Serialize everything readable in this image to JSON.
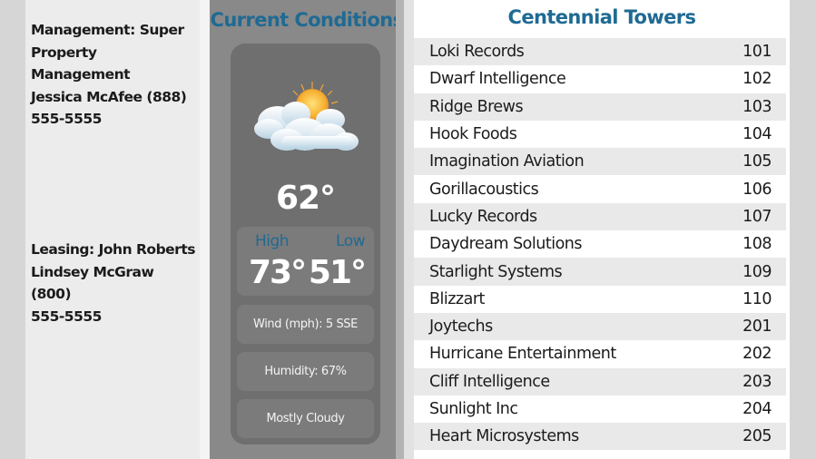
{
  "contacts": {
    "management": {
      "line1": "Management: Super",
      "line2": "Property Management",
      "line3": "Jessica McAfee (888)",
      "line4": "555-5555"
    },
    "leasing": {
      "line1": "Leasing: John Roberts",
      "line2": "Lindsey McGraw (800)",
      "line3": "555-5555"
    }
  },
  "weather": {
    "title": "Current Conditions",
    "icon": "partly-cloudy-icon",
    "current_temp": "62°",
    "high_label": "High",
    "low_label": "Low",
    "high_temp": "73°",
    "low_temp": "51°",
    "wind": "Wind (mph): 5 SSE",
    "humidity": "Humidity: 67%",
    "condition": "Mostly Cloudy"
  },
  "directory": {
    "title": "Centennial Towers",
    "tenants": [
      {
        "name": "Loki Records",
        "suite": "101"
      },
      {
        "name": "Dwarf Intelligence",
        "suite": "102"
      },
      {
        "name": "Ridge Brews",
        "suite": "103"
      },
      {
        "name": "Hook Foods",
        "suite": "104"
      },
      {
        "name": "Imagination Aviation",
        "suite": "105"
      },
      {
        "name": "Gorillacoustics",
        "suite": "106"
      },
      {
        "name": "Lucky Records",
        "suite": "107"
      },
      {
        "name": "Daydream Solutions",
        "suite": "108"
      },
      {
        "name": "Starlight Systems",
        "suite": "109"
      },
      {
        "name": "Blizzart",
        "suite": "110"
      },
      {
        "name": "Joytechs",
        "suite": "201"
      },
      {
        "name": "Hurricane Entertainment",
        "suite": "202"
      },
      {
        "name": "Cliff Intelligence",
        "suite": "203"
      },
      {
        "name": "Sunlight Inc",
        "suite": "204"
      },
      {
        "name": "Heart Microsystems",
        "suite": "205"
      }
    ]
  },
  "colors": {
    "accent": "#1f6a93",
    "weather_bg": "#898989",
    "card_bg": "#6f6f6f",
    "row_alt": "#e9e9e9"
  }
}
